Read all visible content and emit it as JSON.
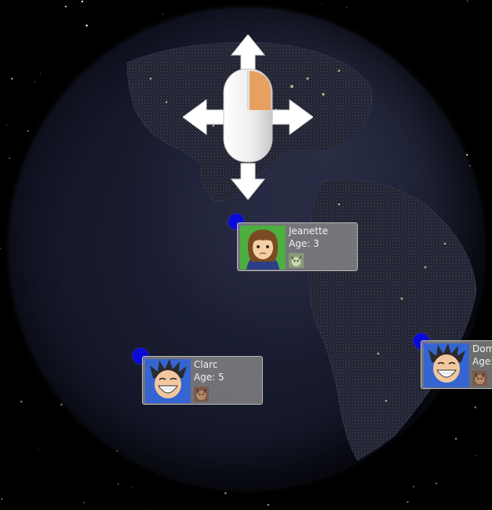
{
  "people": [
    {
      "id": "jeanette",
      "name": "Jeanette",
      "age_label": "Age: 3",
      "portrait_bg": "#3fa03a",
      "pet_icon": "pet-icon"
    },
    {
      "id": "clarc",
      "name": "Clarc",
      "age_label": "Age: 5",
      "portrait_bg": "#2f5fc8",
      "pet_icon": "pet-icon"
    },
    {
      "id": "dom",
      "name": "Dom",
      "age_label": "Age:",
      "portrait_bg": "#2f5fc8",
      "pet_icon": "pet-icon"
    }
  ],
  "controls": {
    "mouse_drag_hint": "mouse-drag-icon",
    "accent": "#e8a060"
  },
  "colors": {
    "pin": "#0a0ad8",
    "card_bg": "#8c8c8c"
  }
}
